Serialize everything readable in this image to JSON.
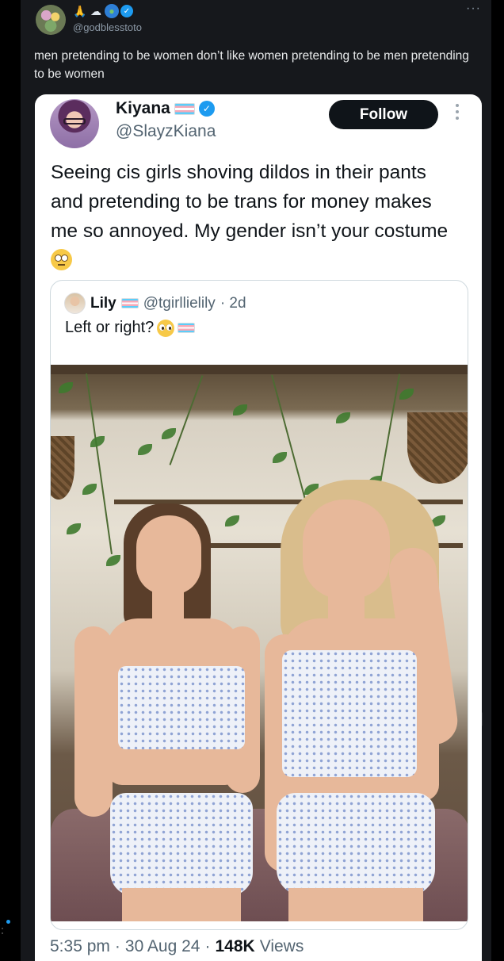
{
  "outer_post": {
    "handle": "@godblesstoto",
    "display_emojis": [
      "pray-icon",
      "cloud-rain-icon",
      "globe-icon",
      "verified-badge-icon"
    ],
    "more_label": "···",
    "text": "men pretending to be women don’t like women pretending to be men pretending to be women"
  },
  "embedded_tweet": {
    "author_name": "Kiyana",
    "author_handle": "@SlayzKiana",
    "follow_label": "Follow",
    "text": "Seeing cis girls shoving dildos in their pants and pretending to be trans for money makes me so annoyed. My gender isn’t your costume",
    "text_emoji": "face-with-rolling-eyes-icon",
    "quote": {
      "author_name": "Lily",
      "author_handle": "@tgirllielily",
      "age": "· 2d",
      "text": "Left or right?",
      "text_emojis": [
        "pleading-face-icon",
        "transgender-flag-icon"
      ]
    },
    "time": "5:35 pm",
    "date": "30 Aug 24",
    "views_count": "148K",
    "views_label": "Views",
    "separator": "·"
  },
  "colors": {
    "background": "#000000",
    "column": "#16181c",
    "card": "#ffffff",
    "accent_blue": "#1d9bf0",
    "text_primary": "#0f1419",
    "text_secondary": "#536471"
  }
}
